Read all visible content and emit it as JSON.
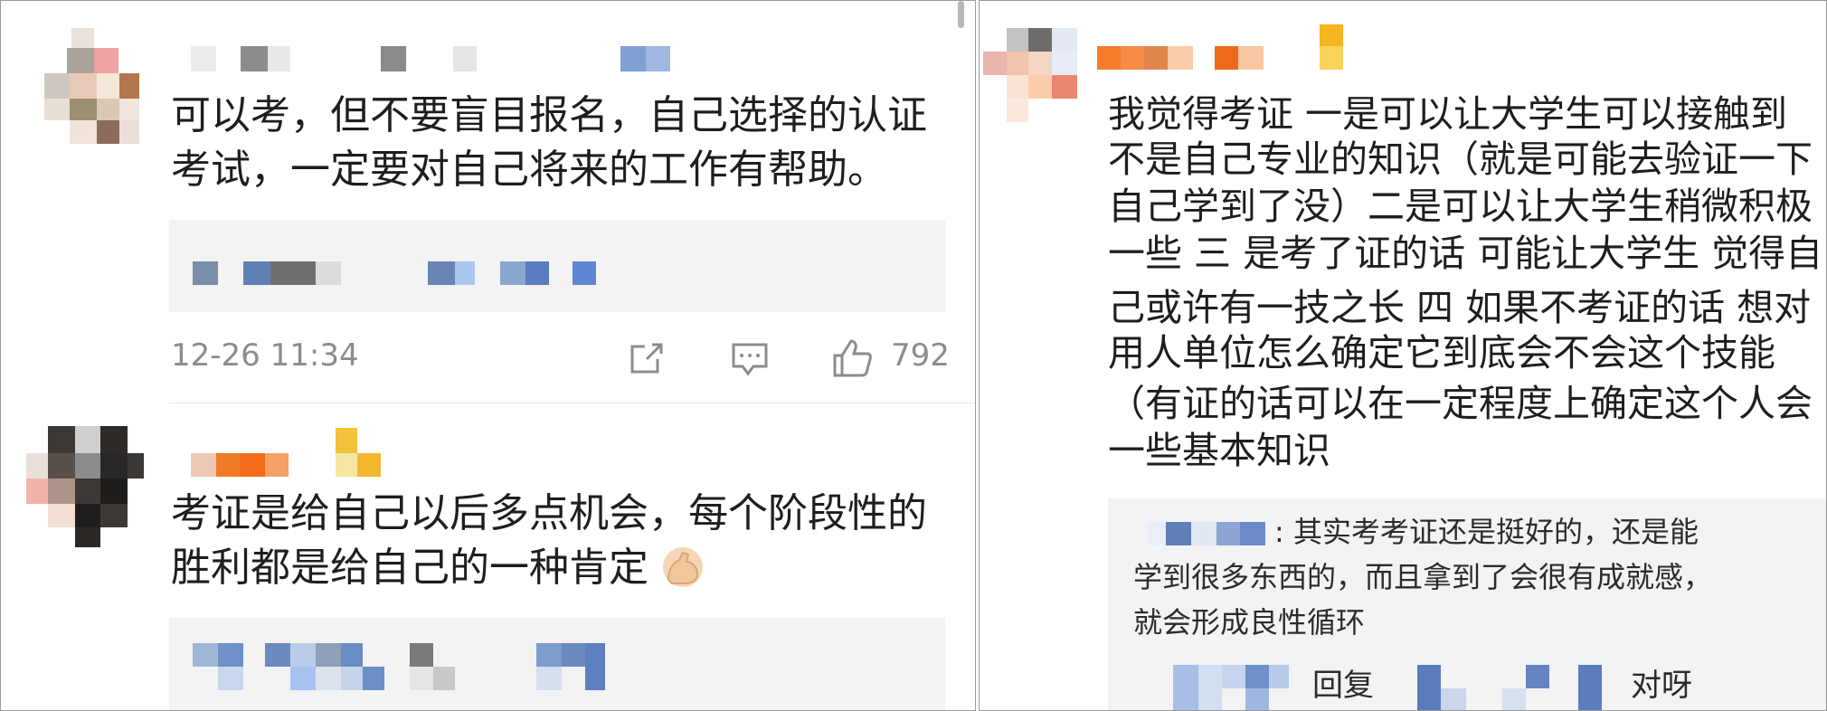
{
  "left": {
    "comment1": {
      "line1": "可以考，但不要盲目报名，自己选择的认证",
      "line2": "考试，一定要对自己将来的工作有帮助。",
      "time": "12-26 11:34",
      "likes": "792"
    },
    "comment2": {
      "line1": "考证是给自己以后多点机会，每个阶段性的",
      "line2": "胜利都是给自己的一种肯定",
      "emoji": "flexed-biceps"
    },
    "icons": {
      "share": "share-icon",
      "reply": "reply-icon",
      "like": "thumbs-up-icon"
    }
  },
  "right": {
    "comment": {
      "lines": [
        "我觉得考证 一是可以让大学生可以接触到",
        "不是自己专业的知识（就是可能去验证一下",
        "自己学到了没）二是可以让大学生稍微积极",
        "一些 三 是考了证的话 可能让大学生 觉得自",
        "己或许有一技之长 四 如果不考证的话 想对",
        "用人单位怎么确定它到底会不会这个技能",
        "（有证的话可以在一定程度上确定这个人会",
        "一些基本知识"
      ]
    },
    "reply": {
      "line1": ": 其实考考证还是挺好的，还是能",
      "line2": "学到很多东西的，而且拿到了会很有成就感，",
      "line3": "就会形成良性循环",
      "nested_reply_label": "回复",
      "nested_reply_text": "对呀"
    }
  },
  "colors": {
    "border": "#9a9a9a",
    "reply_bg": "#f3f3f3",
    "meta_text": "#8c8c8c",
    "username_blur_blue": "#6b8cc4",
    "username_blur_orange": "#f08a3c",
    "badge_yellow": "#f6c23a"
  }
}
